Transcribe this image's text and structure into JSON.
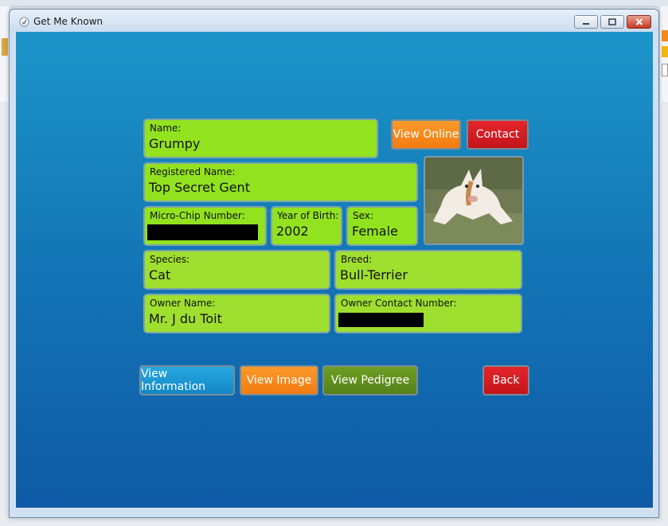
{
  "window": {
    "title": "Get Me Known"
  },
  "form": {
    "name": {
      "label": "Name:",
      "value": "Grumpy"
    },
    "registered_name": {
      "label": "Registered Name:",
      "value": "Top Secret Gent"
    },
    "microchip": {
      "label": "Micro-Chip Number:",
      "value": ""
    },
    "year_of_birth": {
      "label": "Year of Birth:",
      "value": "2002"
    },
    "sex": {
      "label": "Sex:",
      "value": "Female"
    },
    "species": {
      "label": "Species:",
      "value": "Cat"
    },
    "breed": {
      "label": "Breed:",
      "value": "Bull-Terrier"
    },
    "owner_name": {
      "label": "Owner Name:",
      "value": "Mr. J du Toit"
    },
    "owner_contact": {
      "label": "Owner Contact Number:",
      "value": ""
    }
  },
  "actions": {
    "view_online": "View Online",
    "contact": "Contact",
    "view_information": "View Information",
    "view_image": "View Image",
    "view_pedigree": "View Pedigree",
    "back": "Back"
  },
  "colors": {
    "field_bg": "#92e21f",
    "orange": "#f7861d",
    "red": "#d11d22",
    "blue": "#1f9cd6",
    "green": "#62901e"
  }
}
